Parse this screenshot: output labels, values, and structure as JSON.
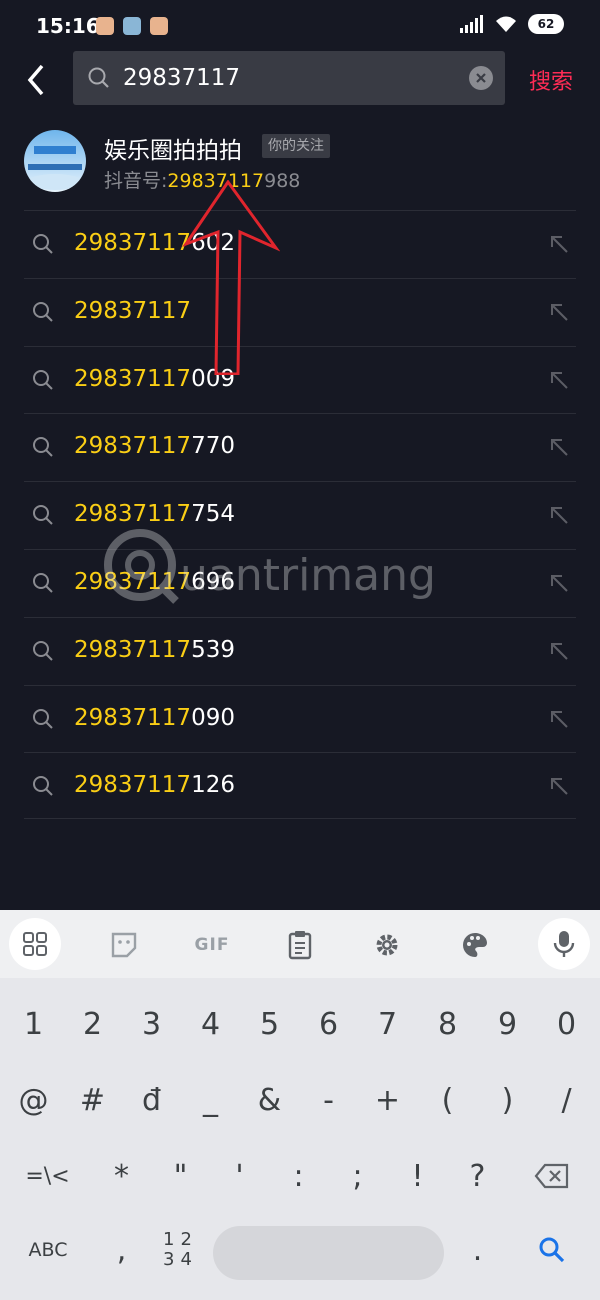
{
  "status_bar": {
    "time": "15:16",
    "battery": "62"
  },
  "search": {
    "query": "29837117",
    "action_label": "搜索"
  },
  "user_result": {
    "name": "娱乐圈拍拍拍",
    "follow_tag": "你的关注",
    "id_prefix": "抖音号:",
    "id_match": "29837117",
    "id_rest": "988"
  },
  "suggestions": [
    {
      "match": "29837117",
      "rest": "602"
    },
    {
      "match": "29837117",
      "rest": ""
    },
    {
      "match": "29837117",
      "rest": "009"
    },
    {
      "match": "29837117",
      "rest": "770"
    },
    {
      "match": "29837117",
      "rest": "754"
    },
    {
      "match": "29837117",
      "rest": "696"
    },
    {
      "match": "29837117",
      "rest": "539"
    },
    {
      "match": "29837117",
      "rest": "090"
    },
    {
      "match": "29837117",
      "rest": "126"
    }
  ],
  "watermark": {
    "text": "uantrimang"
  },
  "keyboard": {
    "toolbar": {
      "gif_label": "GIF"
    },
    "row1": [
      "1",
      "2",
      "3",
      "4",
      "5",
      "6",
      "7",
      "8",
      "9",
      "0"
    ],
    "row2": [
      "@",
      "#",
      "đ",
      "_",
      "&",
      "-",
      "+",
      "(",
      ")",
      "/"
    ],
    "row3": [
      "=\\<",
      "*",
      "\"",
      "'",
      ":",
      ";",
      "!",
      "?"
    ],
    "row4": {
      "abc_label": "ABC",
      "comma": ",",
      "numpad_top": "12",
      "numpad_bottom": "34",
      "period": "."
    }
  },
  "colors": {
    "background": "#161823",
    "highlight": "#face15",
    "accent": "#fe2c55",
    "annotation": "#e0252d"
  }
}
